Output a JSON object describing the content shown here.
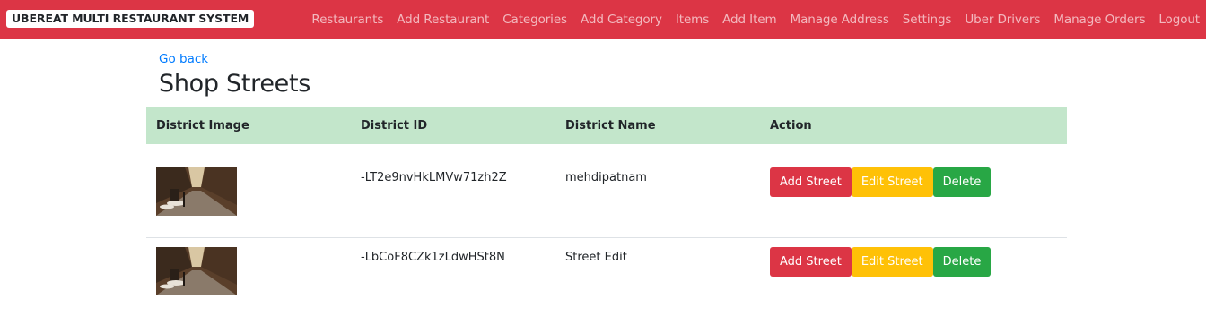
{
  "navbar": {
    "brand": "UBEREAT MULTI RESTAURANT SYSTEM",
    "links": [
      {
        "label": "Restaurants"
      },
      {
        "label": "Add Restaurant"
      },
      {
        "label": "Categories"
      },
      {
        "label": "Add Category"
      },
      {
        "label": "Items"
      },
      {
        "label": "Add Item"
      },
      {
        "label": "Manage Address"
      },
      {
        "label": "Settings"
      },
      {
        "label": "Uber Drivers"
      },
      {
        "label": "Manage Orders"
      },
      {
        "label": "Logout"
      }
    ],
    "color": "#dc3545"
  },
  "page": {
    "go_back": "Go back",
    "title": "Shop Streets"
  },
  "table": {
    "headers": [
      "District Image",
      "District ID",
      "District Name",
      "Action"
    ],
    "header_color": "#c3e6cb",
    "rows": [
      {
        "district_id": "-LT2e9nvHkLMVw71zh2Z",
        "district_name": "mehdipatnam"
      },
      {
        "district_id": "-LbCoF8CZk1zLdwHSt8N",
        "district_name": "Street Edit"
      }
    ],
    "actions": {
      "add_street": "Add Street",
      "edit_street": "Edit Street",
      "delete": "Delete"
    }
  }
}
